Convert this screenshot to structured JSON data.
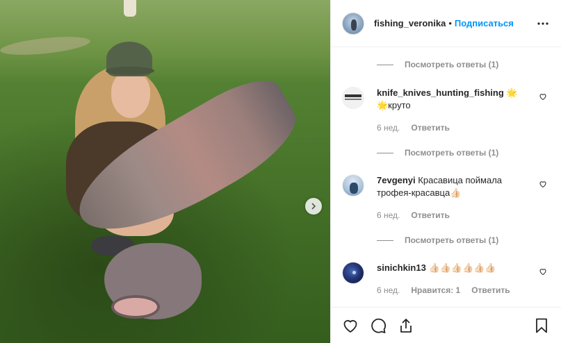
{
  "header": {
    "username": "fishing_veronika",
    "separator": "•",
    "follow_label": "Подписаться",
    "more_icon": "more-horizontal-icon"
  },
  "comments": [
    {
      "view_replies_before": "Посмотреть ответы (1)",
      "username": "knife_knives_hunting_fishing",
      "text": "🌟крyто",
      "username_suffix": "🌟",
      "time": "6 нед.",
      "likes": "",
      "reply_label": "Ответить",
      "view_replies_after": "Посмотреть ответы (1)"
    },
    {
      "username": "7evgenyi",
      "text": "Красавица поймала трофея-красавца👍🏻",
      "time": "6 нед.",
      "likes": "",
      "reply_label": "Ответить",
      "view_replies_after": "Посмотреть ответы (1)"
    },
    {
      "username": "sinichkin13",
      "text": "👍🏻👍🏻👍🏻👍🏻👍🏻👍🏻",
      "time": "6 нед.",
      "likes": "Нравится: 1",
      "reply_label": "Ответить"
    }
  ],
  "actions": {
    "like_icon": "heart-icon",
    "comment_icon": "comment-icon",
    "share_icon": "share-icon",
    "save_icon": "bookmark-icon"
  },
  "photo": {
    "next_icon": "chevron-right-icon"
  },
  "colors": {
    "link_blue": "#0095f6",
    "muted": "#8e8e8e",
    "text": "#262626",
    "border": "#efefef"
  }
}
